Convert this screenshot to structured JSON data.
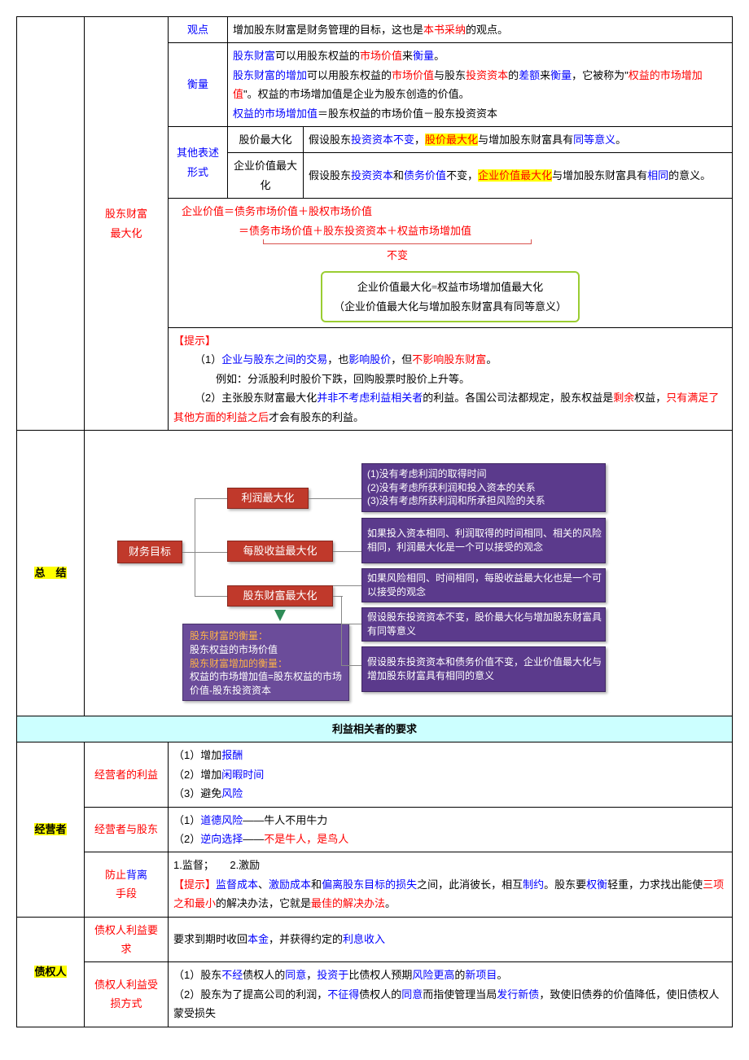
{
  "row1": {
    "col2": "股东财富\n最大化",
    "viewpoint_label": "观点",
    "viewpoint_pre": "增加股东财富是财务管理的目标，这也是",
    "viewpoint_em": "本书采纳",
    "viewpoint_post": "的观点。",
    "measure_label": "衡量",
    "m1a": "股东财富",
    "m1b": "可以用股东权益的",
    "m1c": "市场价值",
    "m1d": "来",
    "m1e": "衡量",
    "m1f": "。",
    "m2a": "股东财富的增加",
    "m2b": "可以用股东权益的",
    "m2c": "市场价值",
    "m2d": "与股东",
    "m2e": "投资资本",
    "m2f": "的",
    "m2g": "差额",
    "m2h": "来",
    "m2i": "衡量",
    "m2j": "，它被称为\"",
    "m2k": "权益的市场增加值",
    "m2l": "\"。权益的市场增加值是企业为股东创造的价值。",
    "m3a": "权益的市场增加值",
    "m3b": "＝股东权益的市场价值－股东投资资本",
    "other_label": "其他表述形式",
    "o1_sub": "股价最大化",
    "o1a": "假设股东",
    "o1b": "投资资本不变",
    "o1c": "，",
    "o1d": "股价最大化",
    "o1e": "与增加股东财富具有",
    "o1f": "同等意义",
    "o1g": "。",
    "o2_sub": "企业价值最大化",
    "o2a": "假设股东",
    "o2b": "投资资本",
    "o2c": "和",
    "o2d": "债务价值",
    "o2e": "不变，",
    "o2f": "企业价值最大化",
    "o2g": "与增加股东财富具有",
    "o2h": "相同",
    "o2i": "的意义。",
    "f1": "企业价值＝债务市场价值＋股权市场价值",
    "f2": "＝债务市场价值＋股东投资资本＋权益市场增加值",
    "fnote": "不变",
    "fb1": "企业价值最大化=权益市场增加值最大化",
    "fb2": "（企业价值最大化与增加股东财富具有同等意义）",
    "tip_label": "【提示】",
    "t1a": "（1）",
    "t1b": "企业与股东之间的交易",
    "t1c": "，也",
    "t1d": "影响股价",
    "t1e": "，但",
    "t1f": "不影响股东财富",
    "t1g": "。",
    "t1ex": "例如：分派股利时股价下跌，回购股票时股价上升等。",
    "t2a": "（2）主张股东财富最大化",
    "t2b": "并非不考虑利益相关者",
    "t2c": "的利益。各国公司法都规定，股东权益是",
    "t2d": "剩余",
    "t2e": "权益，",
    "t2f": "只有满足了其他方面的利益之后",
    "t2g": "才会有股东的利益。"
  },
  "summary_label": "总　结",
  "diagram": {
    "root": "财务目标",
    "n1": "利润最大化",
    "n2": "每股收益最大化",
    "n3": "股东财富最大化",
    "p1": "(1)没有考虑利润的取得时间\n(2)没有考虑所获利润和投入资本的关系\n(3)没有考虑所获利润和所承担风险的关系",
    "p2": "如果投入资本相同、利润取得的时间相同、相关的风险相同，利润最大化是一个可以接受的观念",
    "p3": "如果风险相同、时间相同，每股收益最大化也是一个可以接受的观念",
    "p4": "假设股东投资资本不变，股价最大化与增加股东财富具有同等意义",
    "p5": "假设股东投资资本和债务价值不变，企业价值最大化与增加股东财富具有相同的意义",
    "box_t1": "股东财富的衡量：",
    "box_l1": "股东权益的市场价值",
    "box_t2": "股东财富增加的衡量：",
    "box_l2": "权益的市场增加值=股东权益的市场价值-股东投资资本"
  },
  "section2_hdr": "利益相关者的要求",
  "mgr": {
    "col1": "经营者",
    "r1_label": "经营者的利益",
    "r1_1a": "（1）增加",
    "r1_1b": "报酬",
    "r1_2a": "（2）增加",
    "r1_2b": "闲暇时间",
    "r1_3a": "（3）避免",
    "r1_3b": "风险",
    "r2_label": "经营者与股东",
    "r2_1a": "（1）",
    "r2_1b": "道德风险",
    "r2_1c": "——牛人不用牛力",
    "r2_2a": "（2）",
    "r2_2b": "逆向选择",
    "r2_2c": "——",
    "r2_2d": "不是牛人，是鸟人",
    "r3_label1": "防止",
    "r3_label2": "背离",
    "r3_label3": "手段",
    "r3_1": "1.监督；　　2.激励",
    "r3_2a": "【提示】",
    "r3_2b": "监督成本",
    "r3_2c": "、",
    "r3_2d": "激励成本",
    "r3_2e": "和",
    "r3_2f": "偏离股东目标的损失",
    "r3_2g": "之间，此消彼长，相互",
    "r3_2h": "制约",
    "r3_2i": "。股东要",
    "r3_2j": "权衡",
    "r3_2k": "轻重，力求找出能使",
    "r3_2l": "三项之和最小",
    "r3_2m": "的解决办法，它就是",
    "r3_2n": "最佳的解决办法",
    "r3_2o": "。"
  },
  "cred": {
    "col1": "债权人",
    "r1_label": "债权人利益要求",
    "r1a": "要求到期时收回",
    "r1b": "本金",
    "r1c": "，并获得约定的",
    "r1d": "利息收入",
    "r2_label": "债权人利益受损方式",
    "r2_1a": "（1）股东",
    "r2_1b": "不经",
    "r2_1c": "债权人的",
    "r2_1d": "同意",
    "r2_1e": "，",
    "r2_1f": "投资于",
    "r2_1g": "比债权人预期",
    "r2_1h": "风险更高",
    "r2_1i": "的",
    "r2_1j": "新项目",
    "r2_1k": "。",
    "r2_2a": "（2）股东为了提高公司的利润，",
    "r2_2b": "不征得",
    "r2_2c": "债权人的",
    "r2_2d": "同意",
    "r2_2e": "而指使管理当局",
    "r2_2f": "发行新债",
    "r2_2g": "，致使旧债券的价值降低，使旧债权人蒙受损失"
  }
}
